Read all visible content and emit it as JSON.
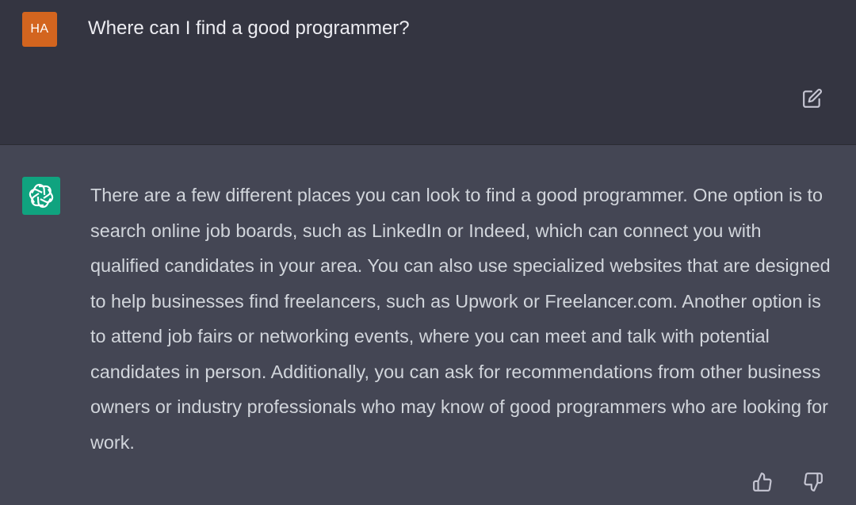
{
  "user": {
    "avatar_initials": "HA",
    "avatar_color": "#d3651f",
    "message": "Where can I find a good programmer?",
    "edit_icon": "edit-icon"
  },
  "assistant": {
    "avatar_icon": "openai-logo-icon",
    "avatar_color": "#10a37f",
    "message": "There are a few different places you can look to find a good programmer. One option is to search online job boards, such as LinkedIn or Indeed, which can connect you with qualified candidates in your area. You can also use specialized websites that are designed to help businesses find freelancers, such as Upwork or Freelancer.com. Another option is to attend job fairs or networking events, where you can meet and talk with potential candidates in person. Additionally, you can ask for recommendations from other business owners or industry professionals who may know of good programmers who are looking for work.",
    "feedback_icons": [
      "thumbs-up-icon",
      "thumbs-down-icon"
    ]
  },
  "colors": {
    "user_row_bg": "#343541",
    "assistant_row_bg": "#444654",
    "user_text": "#ececf1",
    "assistant_text": "#d1d5db",
    "icon": "#c5c5d2"
  }
}
